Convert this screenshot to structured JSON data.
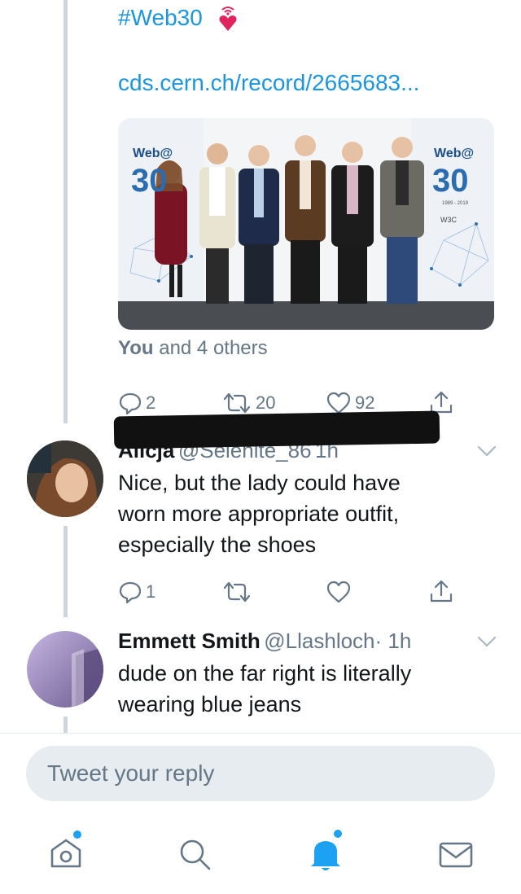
{
  "main_tweet": {
    "hashtag": "#Web30",
    "hashtag_emoji": "heart-emoji",
    "link": "cds.cern.ch/record/2665683...",
    "photo": {
      "left_logo": "Web@ 30",
      "right_logo": "Web@ 30",
      "right_years": "1989 - 2019",
      "w3c_label": "W3C"
    },
    "likes_summary": {
      "bold": "You",
      "rest": " and 4 others"
    },
    "actions": {
      "replies": "2",
      "retweets": "20",
      "likes": "92"
    }
  },
  "replies": [
    {
      "name": "Alicja",
      "handle": "@Selenite_86",
      "time": "1h",
      "text": [
        "Nice, but the lady could have",
        "worn more appropriate outfit,",
        "especially the shoes"
      ],
      "actions": {
        "replies": "1",
        "retweets": "",
        "likes": ""
      }
    },
    {
      "name": "Emmett Smith",
      "handle": "@Llashloch",
      "time": "· 1h",
      "text": [
        "dude on the far right is literally",
        "wearing blue jeans"
      ]
    }
  ],
  "reply_box": {
    "placeholder": "Tweet your reply"
  },
  "bottom_nav": {
    "items": [
      "home-icon",
      "search-icon",
      "notifications-icon",
      "messages-icon"
    ]
  },
  "colors": {
    "accent": "#1da1f2",
    "link": "#1b95e0",
    "muted": "#657786",
    "heart": "#e0245e"
  }
}
